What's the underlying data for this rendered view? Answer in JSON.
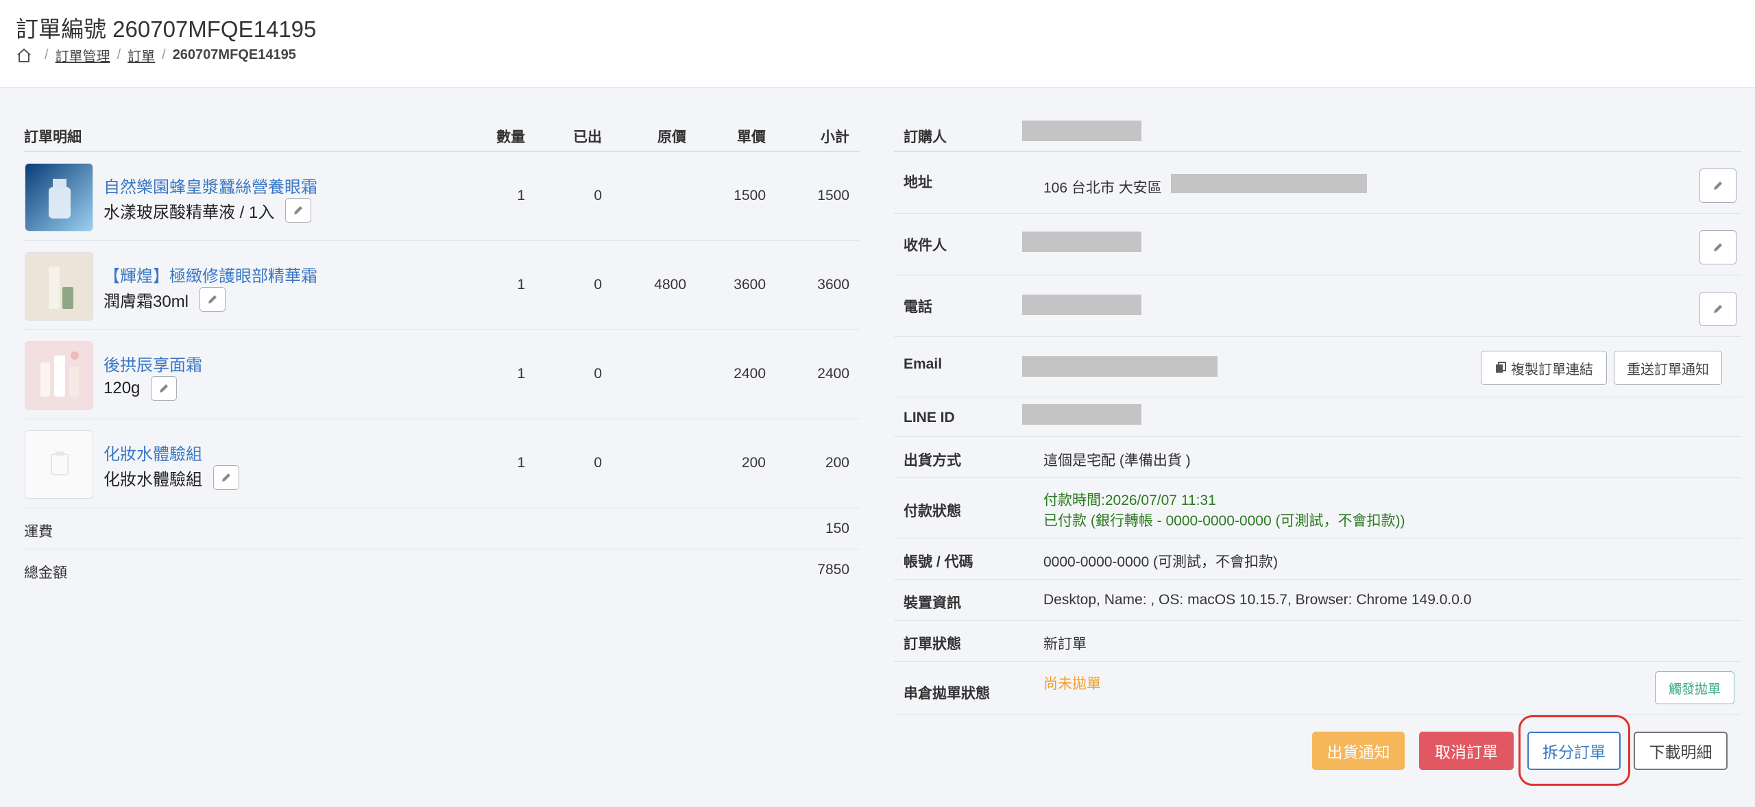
{
  "header": {
    "title": "訂單編號 260707MFQE14195",
    "breadcrumb": [
      "訂單管理",
      "訂單",
      "260707MFQE14195"
    ]
  },
  "items_table": {
    "columns": [
      "訂單明細",
      "數量",
      "已出",
      "原價",
      "單價",
      "小計"
    ],
    "rows": [
      {
        "name": "自然樂園蜂皇漿蠶絲營養眼霜",
        "variant": "水漾玻尿酸精華液 / 1入",
        "qty": "1",
        "shipped": "0",
        "original": "",
        "unit": "1500",
        "subtotal": "1500",
        "thumb": "serum-bottle-image"
      },
      {
        "name": "【輝煌】極緻修護眼部精華霜",
        "variant": "潤膚霜30ml",
        "qty": "1",
        "shipped": "0",
        "original": "4800",
        "unit": "3600",
        "subtotal": "3600",
        "thumb": "cream-bottle-image"
      },
      {
        "name": "後拱辰享面霜",
        "variant": "120g",
        "qty": "1",
        "shipped": "0",
        "original": "",
        "unit": "2400",
        "subtotal": "2400",
        "thumb": "cosmetic-bottles-image"
      },
      {
        "name": "化妝水體驗組",
        "variant": "化妝水體驗組",
        "qty": "1",
        "shipped": "0",
        "original": "",
        "unit": "200",
        "subtotal": "200",
        "thumb": "placeholder-image"
      }
    ],
    "shipping_label": "運費",
    "shipping_value": "150",
    "total_label": "總金額",
    "total_value": "7850"
  },
  "order_info": {
    "buyer_label": "訂購人",
    "address_label": "地址",
    "address_value": "106 台北市 大安區",
    "recipient_label": "收件人",
    "phone_label": "電話",
    "email_label": "Email",
    "copy_link_label": "複製訂單連結",
    "resend_label": "重送訂單通知",
    "line_label": "LINE ID",
    "shipping_method_label": "出貨方式",
    "shipping_method_value": "這個是宅配 (準備出貨 )",
    "payment_status_label": "付款狀態",
    "payment_time": "付款時間:2026/07/07 11:31",
    "payment_detail": "已付款 (銀行轉帳 - 0000-0000-0000 (可測試，不會扣款))",
    "account_label": "帳號 / 代碼",
    "account_value": "0000-0000-0000 (可測試，不會扣款)",
    "device_label": "裝置資訊",
    "device_value": "Desktop, Name: , OS: macOS 10.15.7, Browser: Chrome 149.0.0.0",
    "order_status_label": "訂單狀態",
    "order_status_value": "新訂單",
    "warehouse_label": "串倉拋單狀態",
    "warehouse_value": "尚未拋單",
    "trigger_label": "觸發拋單"
  },
  "actions": {
    "ship_notify": "出貨通知",
    "cancel_order": "取消訂單",
    "split_order": "拆分訂單",
    "download": "下載明細"
  },
  "colors": {
    "link": "#3a78c5",
    "ship": "#f5b75a",
    "cancel": "#e25862",
    "paid": "#2a7a1f",
    "pending": "#f0a030",
    "highlight": "#e0312a"
  }
}
